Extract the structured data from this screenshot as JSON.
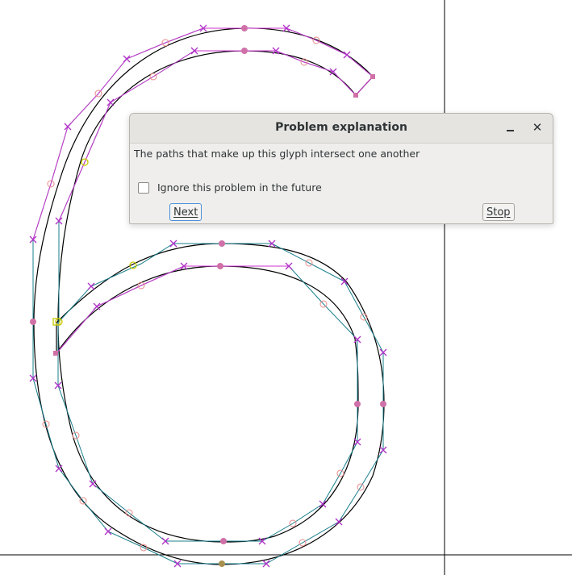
{
  "dialog": {
    "title": "Problem explanation",
    "message": "The paths that make up this glyph intersect one another",
    "ignore_label": "Ignore this problem in the future",
    "ignore_checked": false,
    "next_label": "Next",
    "stop_label": "Stop"
  },
  "colors": {
    "outline": "#000000",
    "control_line_teal": "#1a7f8c",
    "control_line_magenta": "#cc33cc",
    "point_marker": "#cc44cc",
    "on_curve_point": "#d070a8",
    "off_curve_point": "#e88888",
    "selected_point": "#c8c800",
    "guide": "#000000",
    "dialog_bg": "#efeeec"
  }
}
